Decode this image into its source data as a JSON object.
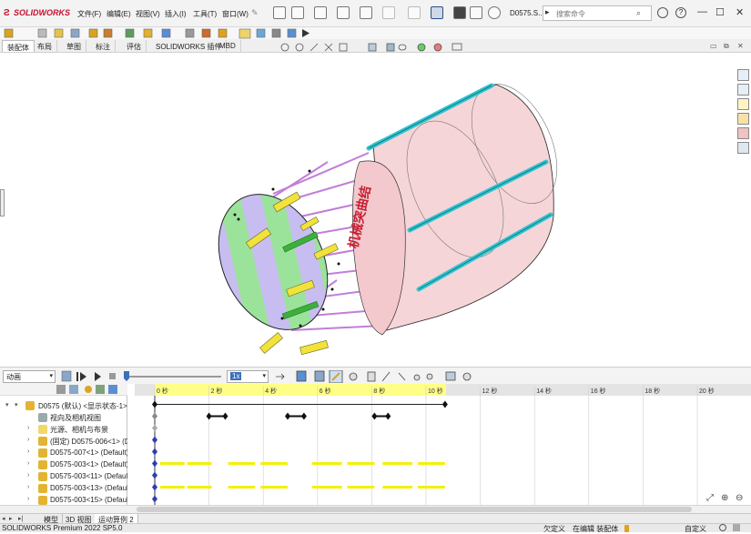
{
  "app": {
    "logo_text": "SOLIDWORKS",
    "document_name": "D0575.S..."
  },
  "menu": [
    "文件(F)",
    "编辑(E)",
    "视图(V)",
    "插入(I)",
    "工具(T)",
    "窗口(W)"
  ],
  "search": {
    "placeholder": "搜索命令"
  },
  "window_controls": {
    "minimize": "—",
    "maximize": "☐",
    "close": "✕"
  },
  "command_tabs": [
    "装配体",
    "布局",
    "草图",
    "标注",
    "评估",
    "SOLIDWORKS 插件",
    "MBD"
  ],
  "model": {
    "label_text": "机械突曲结"
  },
  "motion": {
    "study_type": "动画",
    "speed": "1x",
    "time_ticks": [
      "0 秒",
      "2 秒",
      "4 秒",
      "6 秒",
      "8 秒",
      "10 秒",
      "12 秒",
      "14 秒",
      "16 秒",
      "18 秒",
      "20 秒"
    ],
    "tree": [
      {
        "label": "D0575 (默认) <显示状态-1>",
        "depth": 0,
        "icon": "assembly-icon"
      },
      {
        "label": "视向及相机视图",
        "depth": 1,
        "icon": "camera-icon"
      },
      {
        "label": "光源、相机与布景",
        "depth": 1,
        "icon": "lights-icon"
      },
      {
        "label": "(固定) D0575-006<1> (D",
        "depth": 1,
        "icon": "part-icon"
      },
      {
        "label": "D0575-007<1> (Default)",
        "depth": 1,
        "icon": "part-icon"
      },
      {
        "label": "D0575-003<1> (Default)",
        "depth": 1,
        "icon": "part-icon"
      },
      {
        "label": "D0575-003<11> (Default",
        "depth": 1,
        "icon": "part-icon"
      },
      {
        "label": "D0575-003<13> (Default",
        "depth": 1,
        "icon": "part-icon"
      },
      {
        "label": "D0575-003<15> (Default",
        "depth": 1,
        "icon": "part-icon"
      }
    ],
    "key_pairs_seconds": [
      [
        2.0,
        2.6
      ],
      [
        4.9,
        5.5
      ],
      [
        8.1,
        8.6
      ]
    ]
  },
  "bottom_tabs": [
    "模型",
    "3D 视图",
    "运动算例 2"
  ],
  "status": {
    "left": "SOLIDWORKS Premium 2022 SP5.0",
    "undefined": "欠定义",
    "editing": "在编辑 装配体",
    "custom": "自定义"
  },
  "colors": {
    "accent_red": "#c8102e",
    "timeline_yellow": "#ffff88",
    "selection_blue": "#3c6fb8"
  }
}
